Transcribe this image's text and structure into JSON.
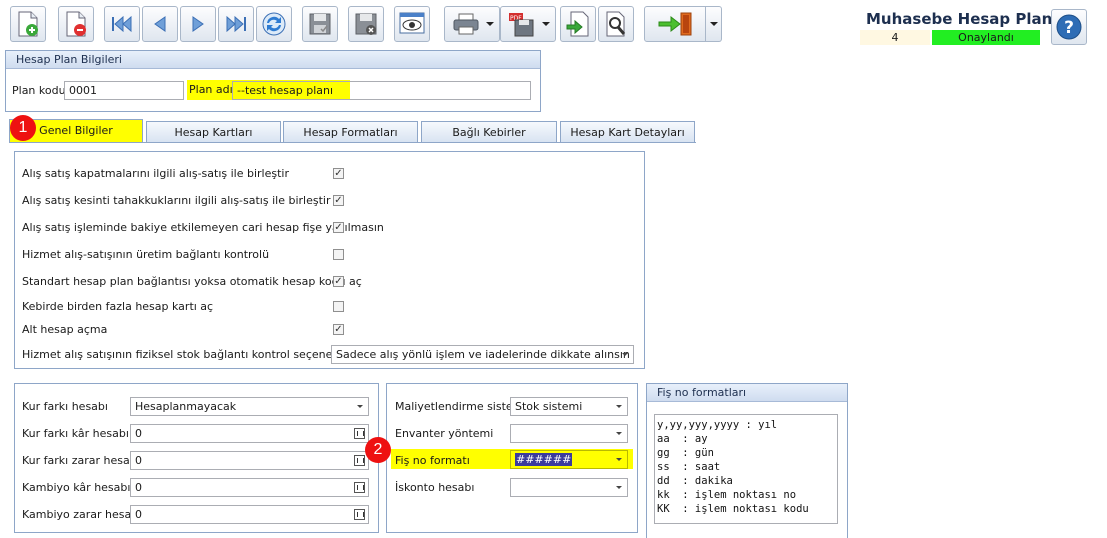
{
  "toolbar": {
    "icons": [
      "new-record-icon",
      "delete-record-icon",
      "first-record-icon",
      "previous-record-icon",
      "next-record-icon",
      "last-record-icon",
      "refresh-icon",
      "save-icon",
      "save-cancel-icon",
      "preview-icon",
      "print-icon",
      "pdf-export-icon",
      "import-icon",
      "search-tool-icon",
      "exit-icon",
      "help-icon"
    ]
  },
  "header": {
    "title": "Muhasebe Hesap Planı",
    "record_number": "4",
    "status": "Onaylandı",
    "status_color": "#22ee22"
  },
  "plan_info": {
    "title": "Hesap Plan Bilgileri",
    "code_label": "Plan kodu",
    "code_value": "0001",
    "name_label": "Plan adı",
    "name_value": "--test hesap planı"
  },
  "tabs": [
    "Genel Bilgiler",
    "Hesap Kartları",
    "Hesap Formatları",
    "Bağlı Kebirler",
    "Hesap Kart Detayları"
  ],
  "markers": [
    "1",
    "2"
  ],
  "general": {
    "options": [
      {
        "label": "Alış satış kapatmalarını ilgili alış-satış ile birleştir",
        "checked": true
      },
      {
        "label": "Alış satış kesinti tahakkuklarını ilgili alış-satış ile birleştir",
        "checked": true
      },
      {
        "label": "Alış satış işleminde bakiye etkilemeyen cari hesap fişe yazılmasın",
        "checked": true
      },
      {
        "label": "Hizmet alış-satışının üretim bağlantı kontrolü",
        "checked": false
      },
      {
        "label": "Standart hesap plan bağlantısı yoksa otomatik hesap kodu aç",
        "checked": true
      },
      {
        "label": "Kebirde birden fazla hesap kartı aç",
        "checked": false
      },
      {
        "label": "Alt hesap açma",
        "checked": true
      }
    ],
    "stock_link_label": "Hizmet alış satışının fiziksel stok bağlantı kontrol seçenekleri",
    "stock_link_value": "Sadece alış yönlü işlem ve iadelerinde dikkate alınsın"
  },
  "currency": {
    "kur_farki_label": "Kur farkı hesabı",
    "kur_farki_value": "Hesaplanmayacak",
    "kur_kar_label": "Kur farkı kâr hesabı",
    "kur_kar_value": "0",
    "kur_zarar_label": "Kur farkı zarar hesabı",
    "kur_zarar_value": "0",
    "kambiyo_kar_label": "Kambiyo kâr hesabı",
    "kambiyo_kar_value": "0",
    "kambiyo_zarar_label": "Kambiyo zarar hesabı",
    "kambiyo_zarar_value": "0"
  },
  "costing": {
    "system_label": "Maliyetlendirme sistemi",
    "system_value": "Stok sistemi",
    "inventory_label": "Envanter yöntemi",
    "inventory_value": "",
    "fis_format_label": "Fiş no formatı",
    "fis_format_value": "######",
    "discount_label": "İskonto hesabı",
    "discount_value": ""
  },
  "fis_formats": {
    "title": "Fiş no formatları",
    "lines": [
      "y,yy,yyy,yyyy : yıl",
      "aa  : ay",
      "gg  : gün",
      "ss  : saat",
      "dd  : dakika",
      "kk  : işlem noktası no",
      "KK  : işlem noktası kodu"
    ]
  }
}
